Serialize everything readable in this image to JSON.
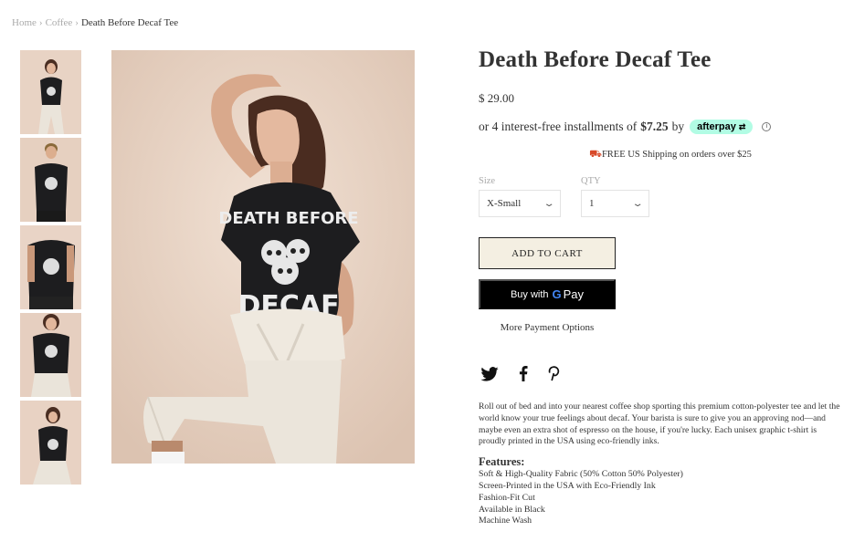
{
  "breadcrumb": {
    "home": "Home",
    "category": "Coffee",
    "current": "Death Before Decaf Tee",
    "separator": "›"
  },
  "product": {
    "title": "Death Before Decaf Tee",
    "price": "$ 29.00",
    "afterpay": {
      "prefix": "or 4 interest-free installments of",
      "amount": "$7.25",
      "by": "by",
      "badge": "afterpay",
      "badge_arrow": "⇄",
      "info_icon": "i"
    },
    "shipping": "FREE US Shipping on orders over $25",
    "shipping_icon": "truck-icon",
    "size": {
      "label": "Size",
      "value": "X-Small"
    },
    "qty": {
      "label": "QTY",
      "value": "1"
    },
    "add_to_cart": "ADD TO CART",
    "gpay": {
      "prefix": "Buy with",
      "g": "G",
      "pay": "Pay"
    },
    "more_payment": "More Payment Options",
    "social_icons": [
      "twitter-icon",
      "facebook-icon",
      "pinterest-icon"
    ],
    "description": "Roll out of bed and into your nearest coffee shop sporting this premium cotton-polyester tee and let the world know your true feelings about decaf. Your barista is sure to give you an approving nod—and maybe even an extra shot of espresso on the house, if you're lucky. Each unisex graphic t-shirt is proudly printed in the USA using eco-friendly inks.",
    "features_title": "Features:",
    "features": [
      "Soft & High-Quality Fabric (50% Cotton 50% Polyester)",
      "Screen-Printed in the USA with Eco-Friendly Ink",
      "Fashion-Fit Cut",
      "Available in Black",
      "Machine Wash"
    ],
    "shirt_print": {
      "top": "DEATH BEFORE",
      "bottom": "DECAF"
    }
  },
  "colors": {
    "backdrop": "#ecd9cb",
    "shirt": "#1d1d1f",
    "pants": "#eae4da",
    "afterpay_mint": "#b2fce4",
    "cart_bg": "#f4efe2",
    "truck": "#d84a2a"
  }
}
